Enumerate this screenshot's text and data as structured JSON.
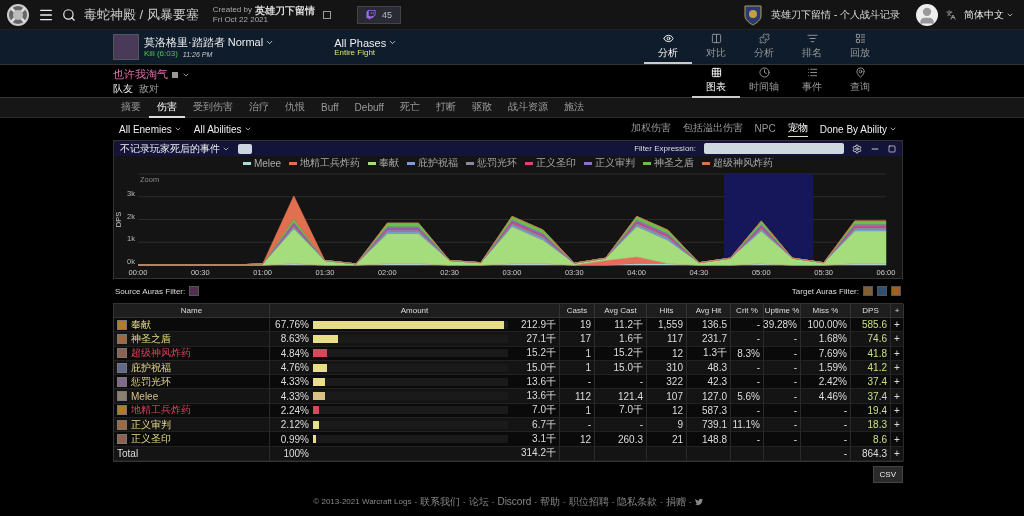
{
  "topbar": {
    "site_title": "毒蛇神殿 / 风暴要塞",
    "created_by_prefix": "Created by",
    "created_by": "英雄刀下留情",
    "date": "Fri Oct 22 2021",
    "viewers": "45",
    "guild_label": "英雄刀下留情 - 个人战斗记录",
    "language": "简体中文"
  },
  "fight": {
    "boss": "莫洛格里·踏踏者 Normal",
    "result": "Kill (6:03)",
    "time": "11:26 PM",
    "phase": "All Phases",
    "phase_sub": "Entire Fight"
  },
  "view_tabs": [
    {
      "label": "分析",
      "selected": true
    },
    {
      "label": "对比",
      "selected": false
    },
    {
      "label": "分析",
      "selected": false
    },
    {
      "label": "排名",
      "selected": false
    },
    {
      "label": "回放",
      "selected": false
    }
  ],
  "player": {
    "name": "也许我淘气",
    "links": [
      {
        "label": "队友",
        "selected": true
      },
      {
        "label": "敌对",
        "selected": false
      }
    ]
  },
  "mode_tabs": [
    {
      "label": "图表",
      "selected": true
    },
    {
      "label": "时间轴",
      "selected": false
    },
    {
      "label": "事件",
      "selected": false
    },
    {
      "label": "查询",
      "selected": false
    }
  ],
  "report_tabs": [
    {
      "label": "摘要",
      "selected": false
    },
    {
      "label": "伤害",
      "selected": true
    },
    {
      "label": "受到伤害",
      "selected": false
    },
    {
      "label": "治疗",
      "selected": false
    },
    {
      "label": "仇恨",
      "selected": false
    },
    {
      "label": "Buff",
      "selected": false
    },
    {
      "label": "Debuff",
      "selected": false
    },
    {
      "label": "死亡",
      "selected": false
    },
    {
      "label": "打断",
      "selected": false
    },
    {
      "label": "驱散",
      "selected": false
    },
    {
      "label": "战斗资源",
      "selected": false
    },
    {
      "label": "施法",
      "selected": false
    }
  ],
  "filters": {
    "enemies": "All Enemies",
    "abilities": "All Abilities",
    "toggles": [
      {
        "label": "加权伤害",
        "selected": false
      },
      {
        "label": "包括溢出伤害",
        "selected": false
      },
      {
        "label": "NPC",
        "selected": false
      },
      {
        "label": "宠物",
        "selected": true
      }
    ],
    "view": "Done By Ability"
  },
  "chart_panel": {
    "death_option": "不记录玩家死后的事件",
    "death_option_checked": false,
    "filter_label": "Filter Expression:",
    "zoom_label": "Zoom",
    "chart_data": {
      "type": "area",
      "stacked": true,
      "ylabel": "DPS",
      "x": [
        0,
        15,
        30,
        45,
        60,
        75,
        90,
        105,
        120,
        135,
        150,
        165,
        180,
        195,
        210,
        225,
        240,
        255,
        270,
        285,
        300,
        315,
        330,
        345,
        360
      ],
      "xlim": [
        0,
        360
      ],
      "ylim": [
        0,
        4000
      ],
      "xticks": [
        {
          "value": 0,
          "label": "00:00"
        },
        {
          "value": 30,
          "label": "00:30"
        },
        {
          "value": 60,
          "label": "01:00"
        },
        {
          "value": 90,
          "label": "01:30"
        },
        {
          "value": 120,
          "label": "02:00"
        },
        {
          "value": 150,
          "label": "02:30"
        },
        {
          "value": 180,
          "label": "03:00"
        },
        {
          "value": 210,
          "label": "03:30"
        },
        {
          "value": 240,
          "label": "04:00"
        },
        {
          "value": 270,
          "label": "04:30"
        },
        {
          "value": 300,
          "label": "05:00"
        },
        {
          "value": 330,
          "label": "05:30"
        },
        {
          "value": 360,
          "label": "06:00"
        }
      ],
      "yticks": [
        {
          "value": 0,
          "label": "0k"
        },
        {
          "value": 1000,
          "label": "1k"
        },
        {
          "value": 2000,
          "label": "2k"
        },
        {
          "value": 3000,
          "label": "3k"
        }
      ],
      "grid": true,
      "bands": [
        {
          "axis": "x",
          "from": 282,
          "to": 325,
          "color": "#16165a"
        }
      ],
      "series": [
        {
          "name": "Melee",
          "color": "#a8dcd8",
          "values": [
            0,
            0,
            0,
            0,
            0,
            60,
            0,
            0,
            60,
            60,
            0,
            0,
            60,
            60,
            0,
            0,
            60,
            60,
            0,
            0,
            60,
            0,
            0,
            60,
            60
          ]
        },
        {
          "name": "地精工兵炸药",
          "color": "#e86a5a",
          "values": [
            0,
            0,
            0,
            0,
            0,
            0,
            0,
            0,
            0,
            0,
            0,
            0,
            0,
            0,
            0,
            200,
            300,
            0,
            0,
            0,
            0,
            0,
            0,
            0,
            0
          ]
        },
        {
          "name": "奉献",
          "color": "#a6dd7c",
          "values": [
            0,
            0,
            0,
            0,
            50,
            1530,
            200,
            50,
            1330,
            1330,
            200,
            100,
            1630,
            1030,
            80,
            100,
            1330,
            1030,
            100,
            300,
            1430,
            300,
            100,
            1430,
            1430
          ]
        },
        {
          "name": "庇护祝福",
          "color": "#7fa0c8",
          "values": [
            0,
            0,
            0,
            0,
            0,
            80,
            0,
            0,
            80,
            80,
            0,
            0,
            80,
            80,
            0,
            0,
            80,
            80,
            0,
            0,
            80,
            0,
            0,
            80,
            80
          ]
        },
        {
          "name": "惩罚光环",
          "color": "#8a8aa0",
          "values": [
            0,
            0,
            0,
            0,
            0,
            80,
            0,
            0,
            80,
            80,
            0,
            0,
            80,
            80,
            0,
            0,
            80,
            80,
            0,
            0,
            80,
            0,
            0,
            80,
            80
          ]
        },
        {
          "name": "正义圣印",
          "color": "#e0407a",
          "values": [
            0,
            0,
            0,
            0,
            0,
            60,
            0,
            0,
            60,
            60,
            0,
            0,
            60,
            60,
            0,
            0,
            60,
            60,
            0,
            0,
            60,
            0,
            0,
            60,
            60
          ]
        },
        {
          "name": "正义审判",
          "color": "#8c70c8",
          "values": [
            0,
            0,
            0,
            0,
            0,
            80,
            0,
            0,
            80,
            80,
            0,
            0,
            80,
            80,
            0,
            0,
            80,
            80,
            0,
            0,
            80,
            0,
            0,
            80,
            80
          ]
        },
        {
          "name": "神圣之盾",
          "color": "#6cc04a",
          "values": [
            0,
            0,
            0,
            0,
            0,
            150,
            0,
            0,
            150,
            150,
            0,
            0,
            150,
            150,
            0,
            0,
            150,
            150,
            0,
            0,
            150,
            0,
            0,
            150,
            150
          ]
        },
        {
          "name": "超级神风炸药",
          "color": "#e07050",
          "values": [
            0,
            0,
            0,
            0,
            0,
            1000,
            0,
            0,
            0,
            0,
            0,
            0,
            0,
            0,
            0,
            0,
            0,
            0,
            0,
            0,
            0,
            0,
            0,
            0,
            0
          ]
        }
      ]
    }
  },
  "auras": {
    "source_label": "Source Auras Filter:",
    "target_label": "Target Auras Filter:"
  },
  "table": {
    "columns": [
      "Name",
      "Amount",
      "Casts",
      "Avg Cast",
      "Hits",
      "Avg Hit",
      "Crit %",
      "Uptime %",
      "Miss %",
      "DPS",
      "+"
    ],
    "rows": [
      {
        "name": "奉献",
        "color": "#e8de8a",
        "pct": "67.76%",
        "level": 0.98,
        "amount": "212.9千",
        "casts": "19",
        "avg_cast": "11.2千",
        "hits": "1,559",
        "avg_hit": "136.5",
        "crit": "-",
        "uptime": "39.28%",
        "miss": "100.00%",
        "dps": "585.6",
        "plus": "+"
      },
      {
        "name": "神圣之盾",
        "color": "#e8de8a",
        "pct": "8.63%",
        "level": 0.127,
        "amount": "27.1千",
        "casts": "17",
        "avg_cast": "1.6千",
        "hits": "117",
        "avg_hit": "231.7",
        "crit": "-",
        "uptime": "-",
        "miss": "1.68%",
        "dps": "74.6",
        "plus": "+"
      },
      {
        "name": "超级神风炸药",
        "color": "#d8475a",
        "pct": "4.84%",
        "level": 0.071,
        "amount": "15.2千",
        "casts": "1",
        "avg_cast": "15.2千",
        "hits": "12",
        "avg_hit": "1.3千",
        "crit": "8.3%",
        "uptime": "-",
        "miss": "7.69%",
        "dps": "41.8",
        "plus": "+"
      },
      {
        "name": "庇护祝福",
        "color": "#e8de8a",
        "pct": "4.76%",
        "level": 0.07,
        "amount": "15.0千",
        "casts": "1",
        "avg_cast": "15.0千",
        "hits": "310",
        "avg_hit": "48.3",
        "crit": "-",
        "uptime": "-",
        "miss": "1.59%",
        "dps": "41.2",
        "plus": "+"
      },
      {
        "name": "惩罚光环",
        "color": "#e8de8a",
        "pct": "4.33%",
        "level": 0.064,
        "amount": "13.6千",
        "casts": "-",
        "avg_cast": "-",
        "hits": "322",
        "avg_hit": "42.3",
        "crit": "-",
        "uptime": "-",
        "miss": "2.42%",
        "dps": "37.4",
        "plus": "+"
      },
      {
        "name": "Melee",
        "color": "#d8c184",
        "pct": "4.33%",
        "level": 0.064,
        "amount": "13.6千",
        "casts": "112",
        "avg_cast": "121.4",
        "hits": "107",
        "avg_hit": "127.0",
        "crit": "5.6%",
        "uptime": "-",
        "miss": "4.46%",
        "dps": "37.4",
        "plus": "+"
      },
      {
        "name": "地精工兵炸药",
        "color": "#d8475a",
        "pct": "2.24%",
        "level": 0.033,
        "amount": "7.0千",
        "casts": "1",
        "avg_cast": "7.0千",
        "hits": "12",
        "avg_hit": "587.3",
        "crit": "-",
        "uptime": "-",
        "miss": "-",
        "dps": "19.4",
        "plus": "+"
      },
      {
        "name": "正义审判",
        "color": "#e8de8a",
        "pct": "2.12%",
        "level": 0.031,
        "amount": "6.7千",
        "casts": "-",
        "avg_cast": "-",
        "hits": "9",
        "avg_hit": "739.1",
        "crit": "11.1%",
        "uptime": "-",
        "miss": "-",
        "dps": "18.3",
        "plus": "+"
      },
      {
        "name": "正义圣印",
        "color": "#e8de8a",
        "pct": "0.99%",
        "level": 0.015,
        "amount": "3.1千",
        "casts": "12",
        "avg_cast": "260.3",
        "hits": "21",
        "avg_hit": "148.8",
        "crit": "-",
        "uptime": "-",
        "miss": "-",
        "dps": "8.6",
        "plus": "+"
      }
    ],
    "total": {
      "name": "Total",
      "pct": "100%",
      "amount": "314.2千",
      "miss": "-",
      "dps": "864.3",
      "plus": "+"
    }
  },
  "csv": "CSV",
  "footer": {
    "separator": "-",
    "copyright": "© 2013-2021 Warcraft Logs",
    "links": [
      "联系我们",
      "论坛",
      "Discord",
      "帮助",
      "职位招聘",
      "隐私条款",
      "捐赠"
    ]
  }
}
